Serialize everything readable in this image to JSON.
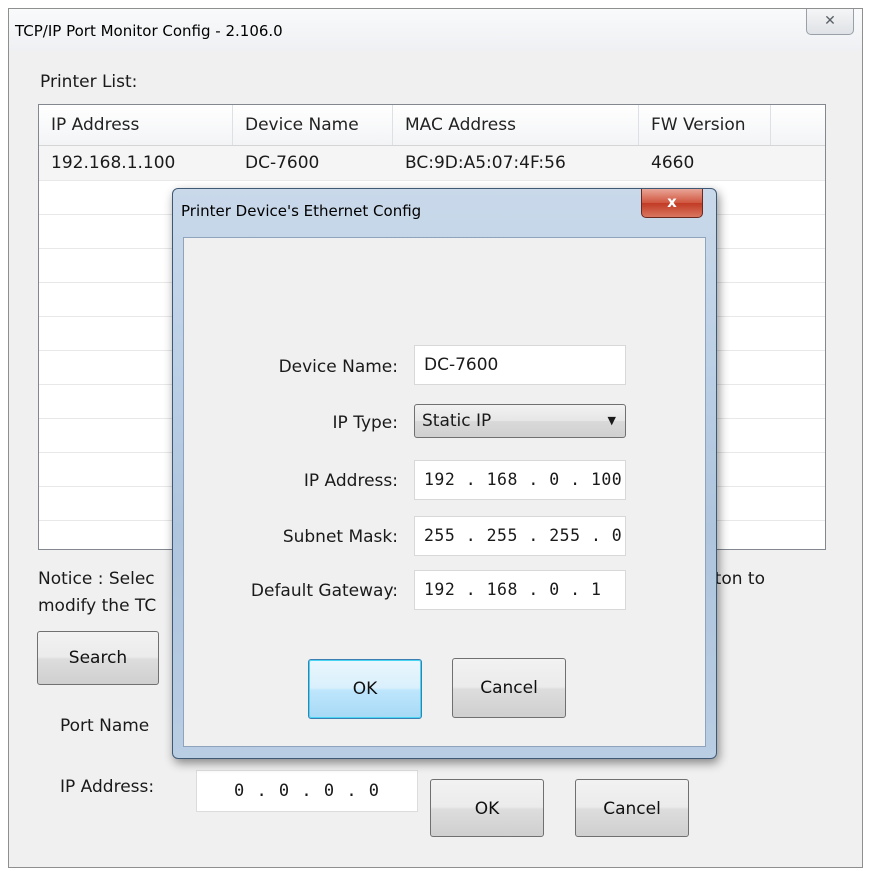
{
  "window": {
    "title": "TCP/IP Port Monitor Config - 2.106.0",
    "close_glyph": "✕"
  },
  "printer_list": {
    "label": "Printer List:",
    "columns": [
      "IP Address",
      "Device Name",
      "MAC Address",
      "FW Version"
    ],
    "rows": [
      [
        "192.168.1.100",
        "DC-7600",
        "BC:9D:A5:07:4F:56",
        "4660"
      ]
    ]
  },
  "notice": {
    "line1_left": "Notice : Selec",
    "line1_right": "tton to",
    "line2_left": "modify the TC"
  },
  "search_button": "Search",
  "port_name_label": "Port Name",
  "ip_address_label": "IP Address:",
  "ip_address_value": "0 . 0 . 0 . 0",
  "ok_button": "OK",
  "cancel_button": "Cancel",
  "dialog": {
    "title": "Printer Device's Ethernet Config",
    "close_glyph": "x",
    "device_name_label": "Device Name:",
    "device_name_value": "DC-7600",
    "ip_type_label": "IP Type:",
    "ip_type_value": "Static IP",
    "ip_address_label": "IP Address:",
    "ip_address_value": "192 . 168 .  0  . 100",
    "subnet_mask_label": "Subnet Mask:",
    "subnet_mask_value": "255 . 255 . 255 .  0",
    "gateway_label": "Default Gateway:",
    "gateway_value": "192 . 168 .  0  .  1",
    "ok_button": "OK",
    "cancel_button": "Cancel"
  }
}
